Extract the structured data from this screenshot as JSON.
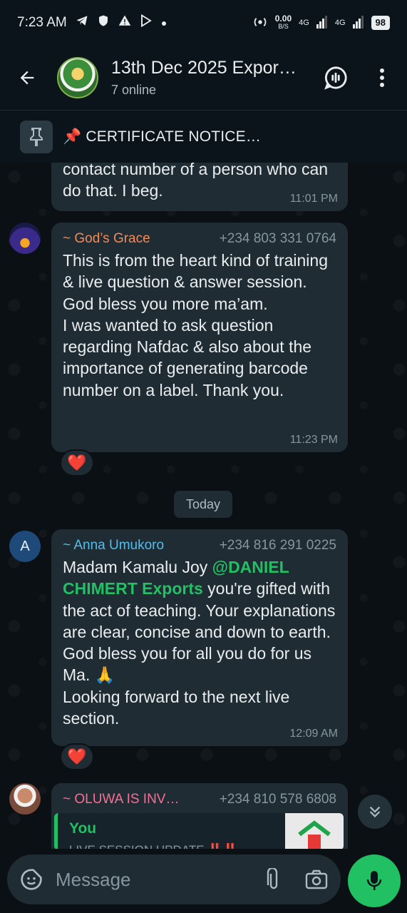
{
  "status_bar": {
    "time": "7:23 AM",
    "net_speed": "0.00",
    "net_unit": "B/S",
    "signal_1": "4G",
    "signal_2": "4G",
    "battery": "98"
  },
  "header": {
    "title": "13th Dec 2025 Expor…",
    "subtitle": "7 online"
  },
  "pinned": {
    "emoji": "📌",
    "text": "CERTIFICATE NOTICE…"
  },
  "messages": [
    {
      "text": "contact number of a person who can do that. I beg.",
      "time": "11:01 PM"
    },
    {
      "sender": "~ God’s Grace",
      "sender_color": "#f28b58",
      "phone": "+234 803 331 0764",
      "text": "This is from the heart kind of training & live question & answer session. God bless you more ma’am.\nI was wanted to ask question regarding Nafdac & also about the importance of generating barcode number on a label. Thank you.",
      "time": "11:23 PM",
      "reaction": "❤️"
    },
    {
      "sender": "~ Anna Umukoro",
      "sender_color": "#53bdeb",
      "phone": "+234 816 291 0225",
      "text_before": "Madam Kamalu Joy ",
      "mention": "@DANIEL CHIMERT Exports",
      "text_after": " you're gifted with the act of teaching. Your explanations are clear, concise and down to earth. God bless you for all you do for us Ma. 🙏\nLooking forward to the next live section.",
      "time": "12:09 AM",
      "reaction": "❤️",
      "avatar_letter": "A"
    },
    {
      "sender": "~ OLUWA IS INV…",
      "sender_color": "#fc6d95",
      "phone": "+234 810 578 6808",
      "quote_author": "You",
      "quote_text": "LIVE SESSION UPDATE ‼️‼️"
    }
  ],
  "date_divider": "Today",
  "composer": {
    "placeholder": "Message"
  },
  "colors": {
    "accent": "#21c063",
    "bubble": "#1f2c33",
    "background": "#0b1014"
  }
}
